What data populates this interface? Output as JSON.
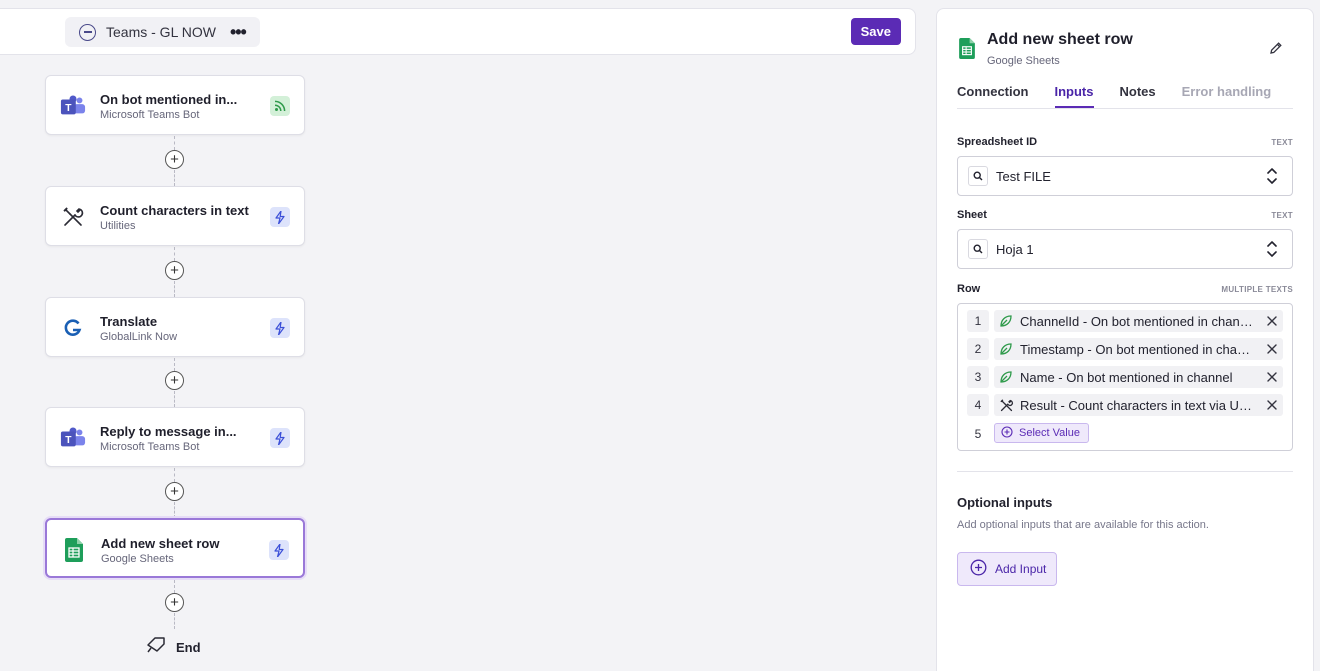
{
  "topbar": {
    "flow_title": "Teams - GL NOW",
    "save_label": "Save"
  },
  "flow": {
    "nodes": [
      {
        "title": "On bot mentioned in...",
        "subtitle": "Microsoft Teams Bot",
        "icon": "teams-icon",
        "badge": "feed-icon"
      },
      {
        "title": "Count characters in text",
        "subtitle": "Utilities",
        "icon": "tools-icon",
        "badge": "bolt-icon"
      },
      {
        "title": "Translate",
        "subtitle": "GlobalLink Now",
        "icon": "globallink-icon",
        "badge": "bolt-icon"
      },
      {
        "title": "Reply to message in...",
        "subtitle": "Microsoft Teams Bot",
        "icon": "teams-icon",
        "badge": "bolt-icon"
      },
      {
        "title": "Add new sheet row",
        "subtitle": "Google Sheets",
        "icon": "google-sheets-icon",
        "badge": "bolt-icon"
      }
    ],
    "end_label": "End"
  },
  "panel": {
    "title": "Add new sheet row",
    "subtitle": "Google Sheets",
    "tabs": [
      {
        "label": "Connection",
        "state": "normal"
      },
      {
        "label": "Inputs",
        "state": "active"
      },
      {
        "label": "Notes",
        "state": "normal"
      },
      {
        "label": "Error handling",
        "state": "disabled"
      }
    ],
    "spreadsheet": {
      "label": "Spreadsheet ID",
      "type": "TEXT",
      "value": "Test FILE"
    },
    "sheet": {
      "label": "Sheet",
      "type": "TEXT",
      "value": "Hoja 1"
    },
    "row": {
      "label": "Row",
      "type": "MULTIPLE TEXTS",
      "items": [
        {
          "num": "1",
          "text": "ChannelId - On bot mentioned in channel",
          "icon": "teams-leaf-icon"
        },
        {
          "num": "2",
          "text": "Timestamp - On bot mentioned in channel",
          "icon": "teams-leaf-icon"
        },
        {
          "num": "3",
          "text": "Name - On bot mentioned in channel",
          "icon": "teams-leaf-icon"
        },
        {
          "num": "4",
          "text": "Result - Count characters in text via Utilities",
          "icon": "tools-icon"
        }
      ],
      "add_num": "5",
      "add_label": "Select Value"
    },
    "optional": {
      "title": "Optional inputs",
      "description": "Add optional inputs that are available for this action.",
      "button_label": "Add Input"
    }
  },
  "colors": {
    "accent": "#5b2bb5",
    "sheets_green": "#1e9e5a",
    "teams_purple": "#5059c9"
  }
}
